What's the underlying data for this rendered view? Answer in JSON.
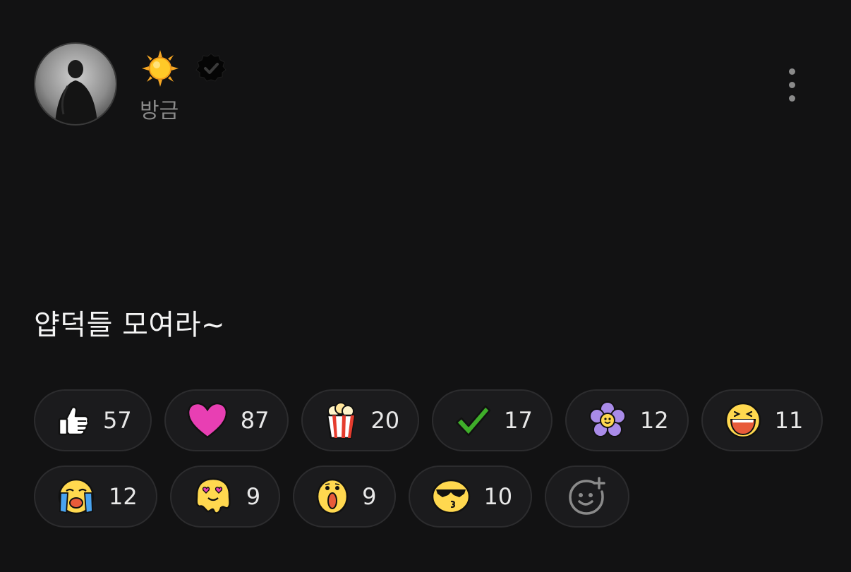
{
  "post": {
    "author_emoji": "☀️",
    "time_label": "방금",
    "text": "얍덕들 모여라~"
  },
  "reactions": [
    {
      "icon": "thumbs-up-icon",
      "count": "57"
    },
    {
      "icon": "heart-icon",
      "count": "87"
    },
    {
      "icon": "popcorn-icon",
      "count": "20"
    },
    {
      "icon": "check-mark-icon",
      "count": "17"
    },
    {
      "icon": "flower-icon",
      "count": "12"
    },
    {
      "icon": "laughing-face-icon",
      "count": "11"
    },
    {
      "icon": "crying-face-icon",
      "count": "12"
    },
    {
      "icon": "melting-love-face-icon",
      "count": "9"
    },
    {
      "icon": "surprised-face-icon",
      "count": "9"
    },
    {
      "icon": "sunglasses-kiss-face-icon",
      "count": "10"
    }
  ],
  "add_reaction_icon": "add-reaction-icon",
  "colors": {
    "background": "#121213",
    "pill_bg": "#1b1b1d",
    "pill_border": "#2c2c2e",
    "muted_text": "#8a8a8a",
    "heart": "#e83fb3",
    "check": "#3fae2a",
    "flower": "#a98be8",
    "emoji_yellow": "#ffd84f"
  }
}
